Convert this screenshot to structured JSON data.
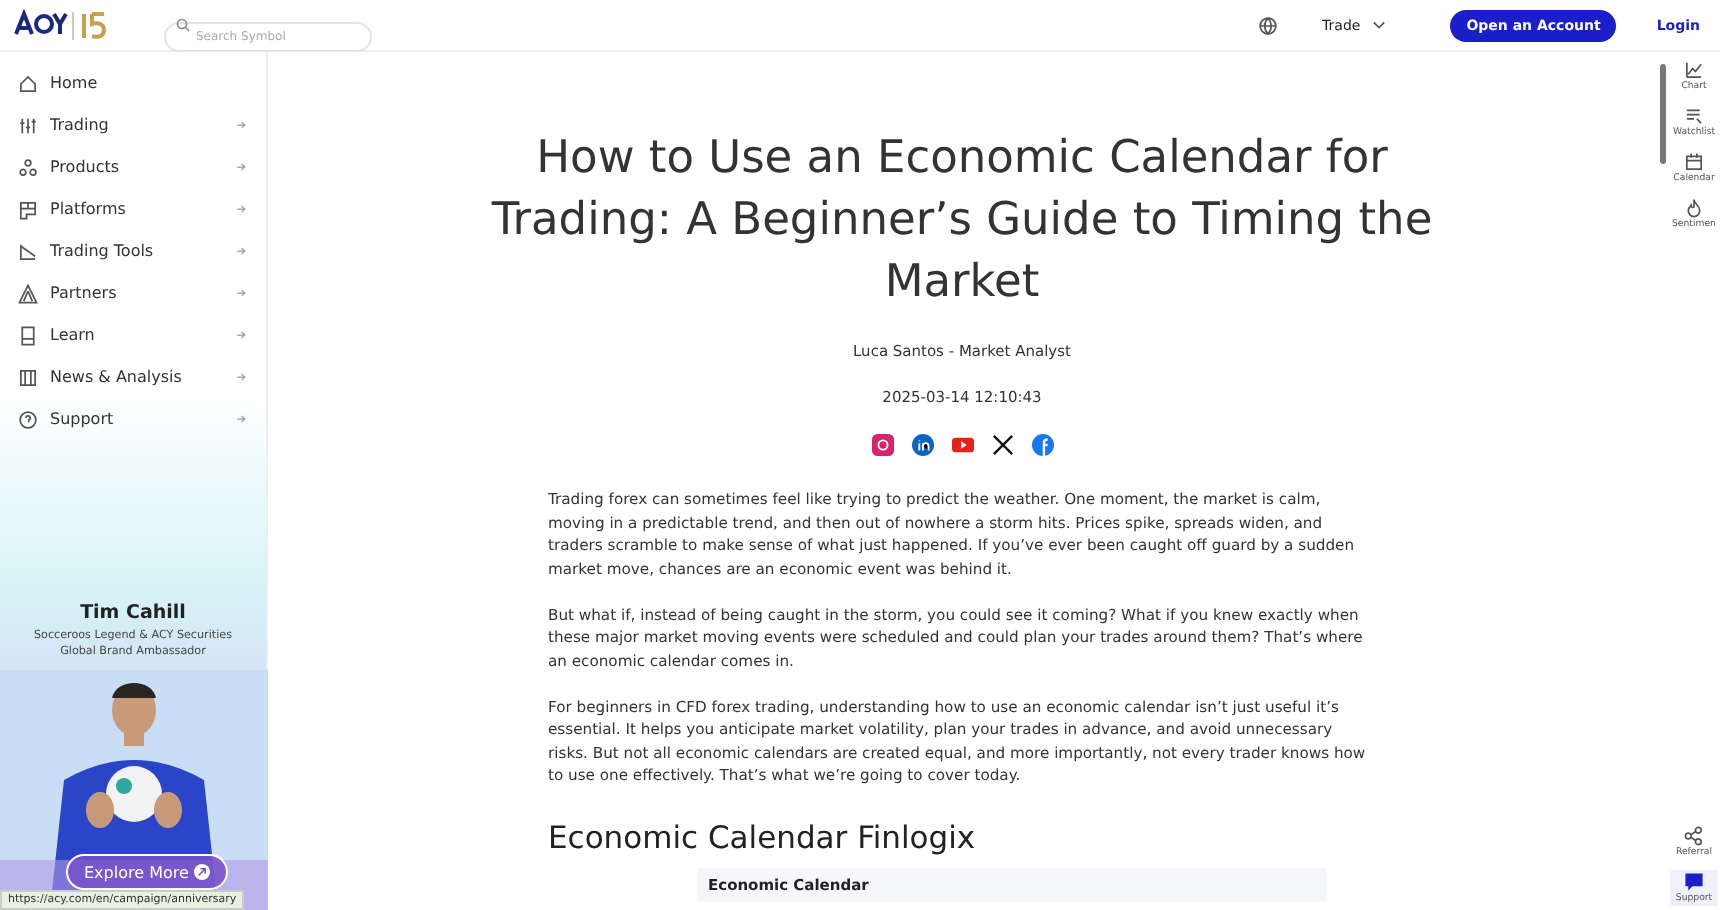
{
  "header": {
    "search": {
      "placeholder": "Search Symbol"
    },
    "menu": "Trade",
    "cta": "Open an Account",
    "login": "Login"
  },
  "sidebar": {
    "items": [
      {
        "label": "Home",
        "arrow": false
      },
      {
        "label": "Trading",
        "arrow": true
      },
      {
        "label": "Products",
        "arrow": true
      },
      {
        "label": "Platforms",
        "arrow": true
      },
      {
        "label": "Trading Tools",
        "arrow": true
      },
      {
        "label": "Partners",
        "arrow": true
      },
      {
        "label": "Learn",
        "arrow": true
      },
      {
        "label": "News & Analysis",
        "arrow": true
      },
      {
        "label": "Support",
        "arrow": true
      }
    ],
    "promo": {
      "name": "Tim Cahill",
      "subtitle": "Socceroos Legend & ACY Securities Global Brand Ambassador",
      "button": "Explore More"
    }
  },
  "article": {
    "title": "How to Use an Economic Calendar for Trading: A Beginner’s Guide to Timing the Market",
    "author": "Luca Santos - Market Analyst",
    "date": "2025-03-14 12:10:43",
    "paragraphs": [
      "Trading forex can sometimes feel like trying to predict the weather. One moment, the market is calm, moving in a predictable trend, and then out of nowhere a storm hits. Prices spike, spreads widen, and traders scramble to make sense of what just happened. If you’ve ever been caught off guard by a sudden market move, chances are an economic event was behind it.",
      "But what if, instead of being caught in the storm, you could see it coming? What if you knew exactly when these major market moving events were scheduled and could plan your trades around them? That’s where an economic calendar comes in.",
      "For beginners in CFD forex trading, understanding how to use an economic calendar isn’t just useful it’s essential. It helps you anticipate market volatility, plan your trades in advance, and avoid unnecessary risks. But not all economic calendars are created equal, and more importantly, not every trader knows how to use one effectively. That’s what we’re going to cover today."
    ],
    "heading": "Economic Calendar Finlogix",
    "widget_title": "Economic Calendar"
  },
  "rail": {
    "top": [
      {
        "label": "Chart",
        "selected": false
      },
      {
        "label": "Watchlist",
        "selected": false
      },
      {
        "label": "Calendar",
        "selected": false
      },
      {
        "label": "Sentimen",
        "selected": false
      }
    ],
    "bottom": [
      {
        "label": "Referral",
        "selected": false
      },
      {
        "label": "Support",
        "selected": true
      }
    ]
  },
  "status_url": "https://acy.com/en/campaign/anniversary"
}
